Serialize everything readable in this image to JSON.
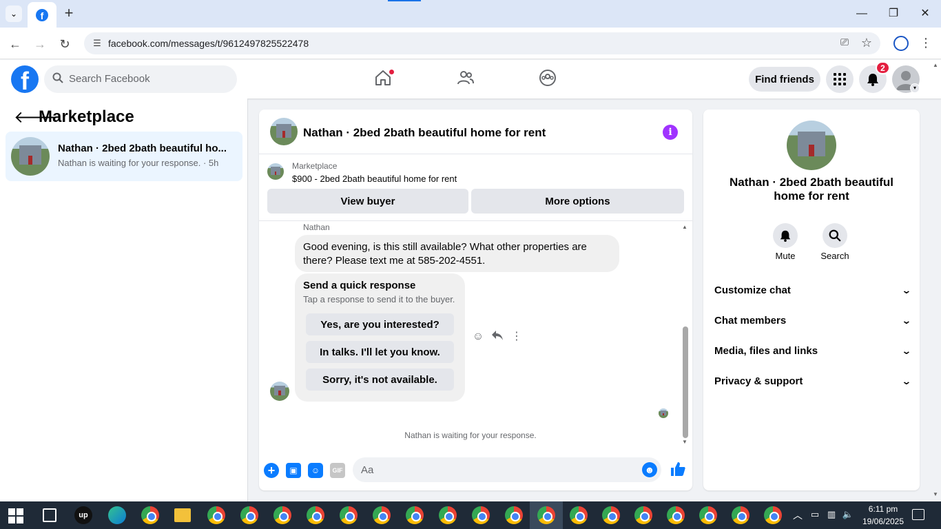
{
  "browser": {
    "url": "facebook.com/messages/t/9612497825522478",
    "new_tab_symbol": "+",
    "tab_list_symbol": "⌄"
  },
  "fb_header": {
    "search_placeholder": "Search Facebook",
    "find_friends": "Find friends",
    "notifications_count": "2"
  },
  "sidebar": {
    "title": "Marketplace",
    "conversation": {
      "title": "Nathan · 2bed 2bath beautiful ho...",
      "subtitle": "Nathan is waiting for your response. · 5h"
    }
  },
  "chat": {
    "title": "Nathan · 2bed 2bath beautiful home for rent",
    "listing_kind": "Marketplace",
    "listing_price_title": "$900 - 2bed 2bath beautiful home for rent",
    "view_buyer": "View buyer",
    "more_options": "More options",
    "sender_name": "Nathan",
    "message": "Good evening, is this still available? What other properties are there? Please text me at 585-202-4551.",
    "quick_response": {
      "title": "Send a quick response",
      "subtitle": "Tap a response to send it to the buyer.",
      "options": [
        "Yes, are you interested?",
        "In talks. I'll let you know.",
        "Sorry, it's not available."
      ]
    },
    "waiting_note": "Nathan is waiting for your response.",
    "composer_placeholder": "Aa",
    "gif_label": "GIF"
  },
  "right_panel": {
    "title": "Nathan · 2bed 2bath beautiful home for rent",
    "mute": "Mute",
    "search": "Search",
    "sections": [
      "Customize chat",
      "Chat members",
      "Media, files and links",
      "Privacy & support"
    ]
  },
  "taskbar": {
    "time": "6:11 pm",
    "date": "19/06/2025",
    "upwork_label": "up"
  },
  "colors": {
    "fb_blue": "#1877f2",
    "messenger_blue": "#0a7cff",
    "info_purple": "#a033ff",
    "badge_red": "#e41e3f"
  },
  "icons": [
    "search-icon",
    "home-icon",
    "friends-icon",
    "groups-icon",
    "apps-grid-icon",
    "bell-icon",
    "info-icon",
    "emoji-icon",
    "like-icon",
    "react-icon",
    "reply-icon",
    "more-icon",
    "mute-bell-icon",
    "chevron-down-icon"
  ]
}
